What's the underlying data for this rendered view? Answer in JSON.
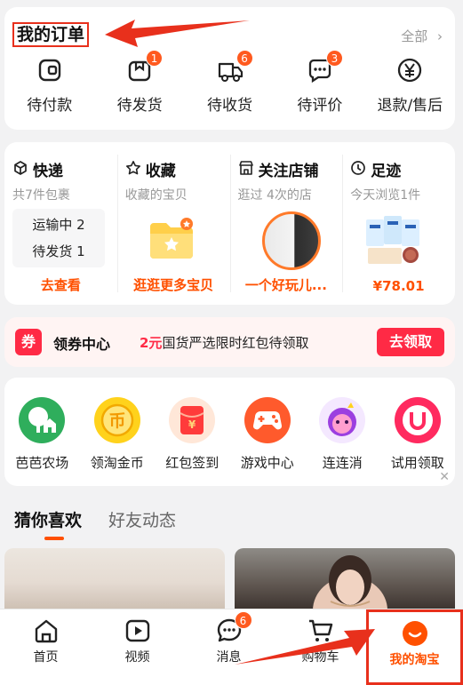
{
  "orders": {
    "title": "我的订单",
    "all_label": "全部",
    "items": [
      {
        "label": "待付款",
        "icon": "wallet-icon",
        "badge": ""
      },
      {
        "label": "待发货",
        "icon": "package-icon",
        "badge": "1"
      },
      {
        "label": "待收货",
        "icon": "truck-icon",
        "badge": "6"
      },
      {
        "label": "待评价",
        "icon": "comment-icon",
        "badge": "3"
      },
      {
        "label": "退款/售后",
        "icon": "yen-icon",
        "badge": ""
      }
    ]
  },
  "feeds": {
    "express": {
      "title": "快递",
      "sub": "共7件包裹",
      "lines": [
        "运输中 2",
        "待发货 1"
      ],
      "link": "去查看"
    },
    "favorites": {
      "title": "收藏",
      "sub": "收藏的宝贝",
      "link": "逛逛更多宝贝"
    },
    "stores": {
      "title": "关注店铺",
      "sub": "逛过 4次的店",
      "link": "一个好玩儿..."
    },
    "footprint": {
      "title": "足迹",
      "sub": "今天浏览1件",
      "link": "¥78.01"
    }
  },
  "coupon": {
    "badge": "券",
    "title": "领券中心",
    "amount": "2元",
    "desc": "国货严选限时红包待领取",
    "button": "去领取"
  },
  "apps": [
    {
      "label": "芭芭农场",
      "icon": "farm-icon"
    },
    {
      "label": "领淘金币",
      "icon": "coin-icon"
    },
    {
      "label": "红包签到",
      "icon": "red-envelope-icon"
    },
    {
      "label": "游戏中心",
      "icon": "gamepad-icon"
    },
    {
      "label": "连连消",
      "icon": "match-game-icon"
    },
    {
      "label": "试用领取",
      "icon": "trial-icon"
    }
  ],
  "feed_tabs": [
    "猜你喜欢",
    "好友动态"
  ],
  "tabbar": [
    {
      "label": "首页",
      "icon": "home-icon",
      "badge": ""
    },
    {
      "label": "视频",
      "icon": "video-icon",
      "badge": ""
    },
    {
      "label": "消息",
      "icon": "message-icon",
      "badge": "6"
    },
    {
      "label": "购物车",
      "icon": "cart-icon",
      "badge": ""
    },
    {
      "label": "我的淘宝",
      "icon": "my-taobao-icon",
      "badge": ""
    }
  ],
  "colors": {
    "accent": "#ff5000",
    "annotation": "#e8301c",
    "coupon_red": "#ff2a45"
  }
}
